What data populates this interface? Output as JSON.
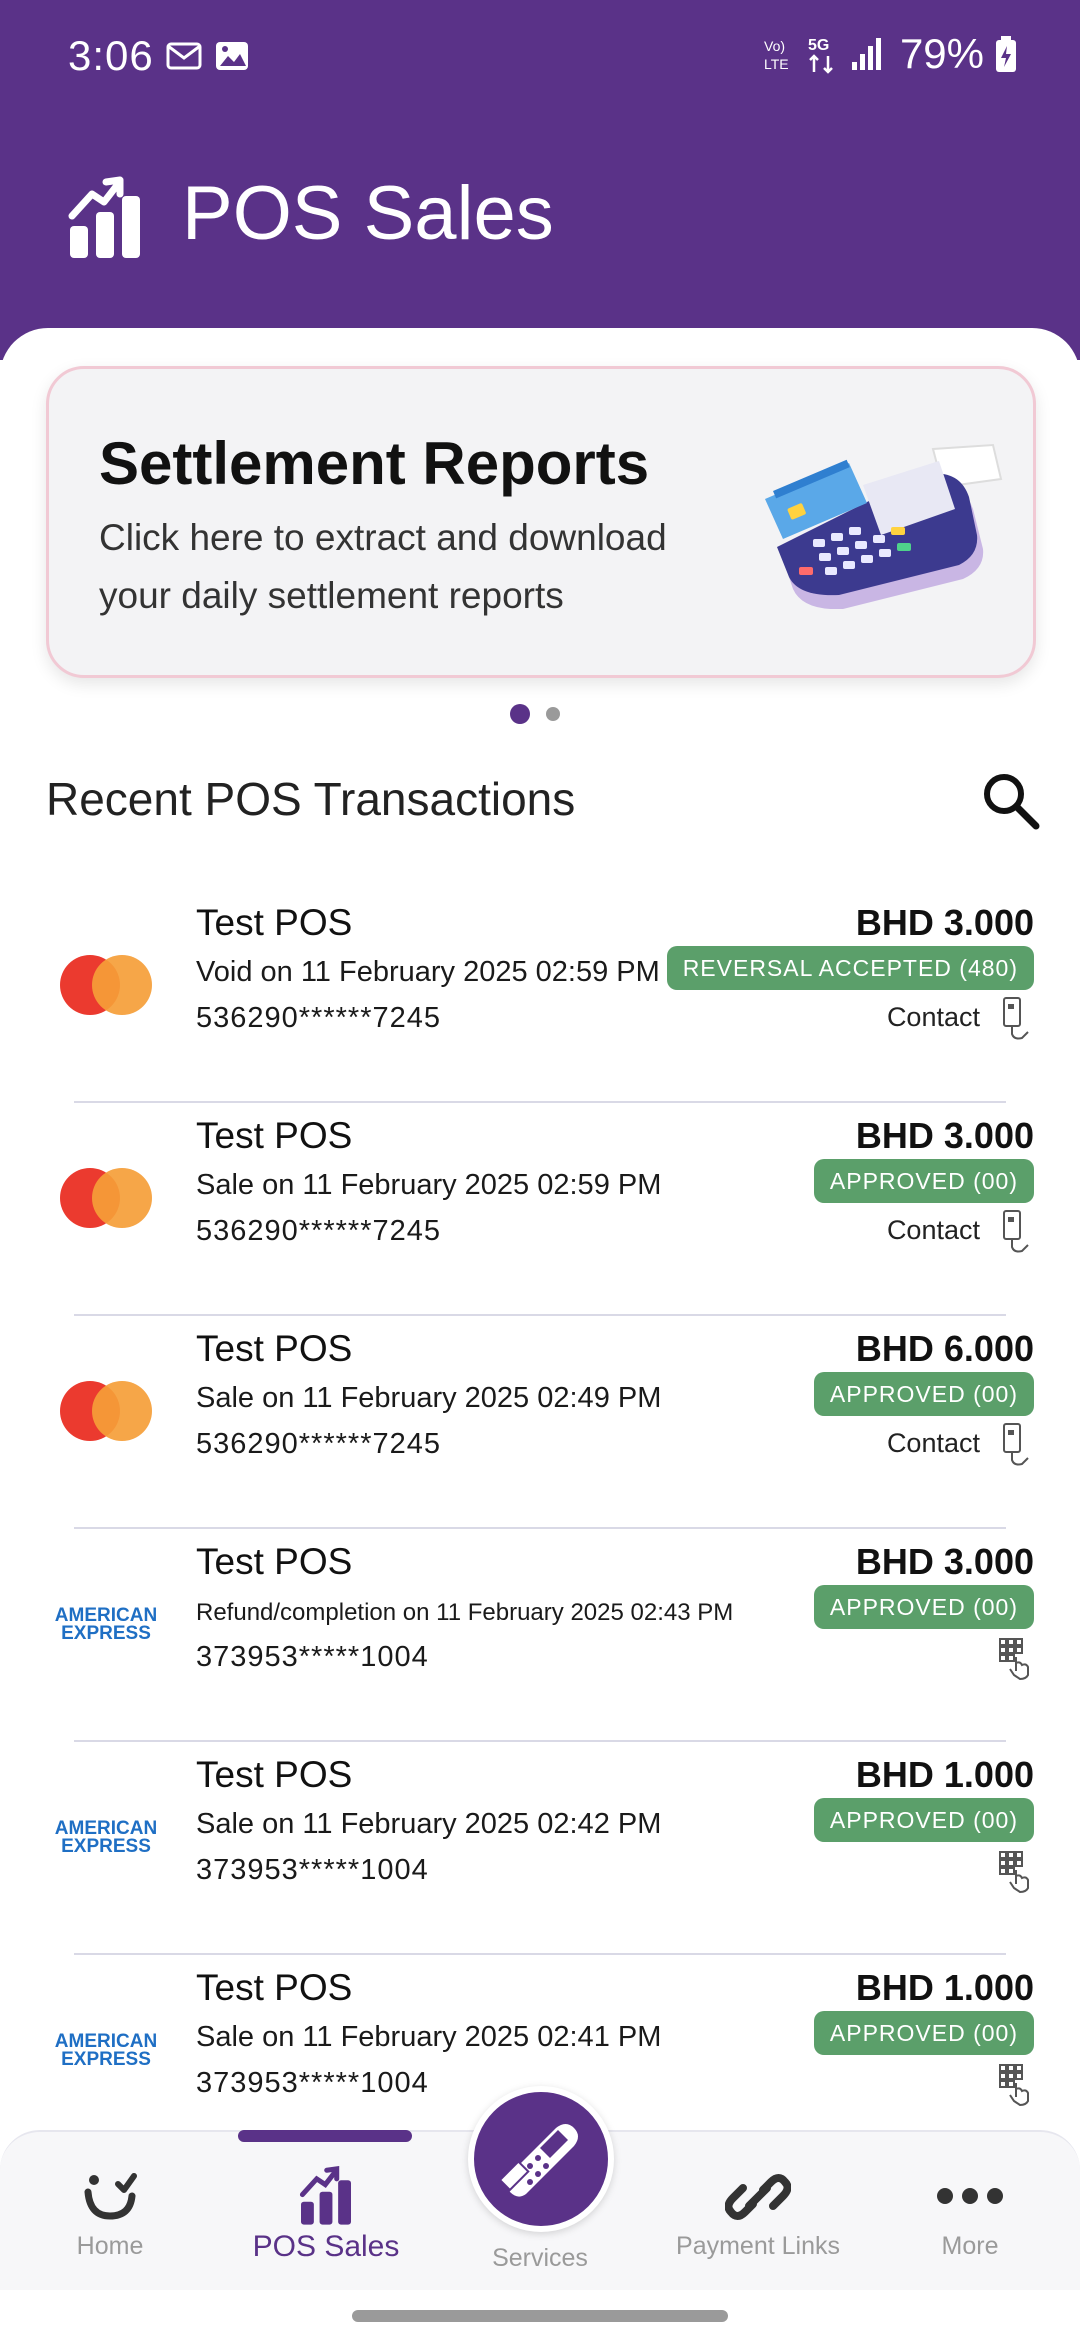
{
  "status_bar": {
    "time": "3:06",
    "battery": "79%",
    "network": "5G"
  },
  "header": {
    "title": "POS Sales",
    "icon": "bar-chart-trend-icon"
  },
  "banner": {
    "title": "Settlement Reports",
    "subtitle": "Click here to extract and download your daily settlement reports",
    "active_page": 1,
    "pages": 2
  },
  "recent": {
    "title": "Recent POS Transactions"
  },
  "transactions": [
    {
      "brand": "mastercard",
      "merchant": "Test POS",
      "description": "Void on 11 February 2025 02:59 PM",
      "pan": "536290******7245",
      "amount": "BHD 3.000",
      "status": "REVERSAL ACCEPTED (480)",
      "entry": "Contact"
    },
    {
      "brand": "mastercard",
      "merchant": "Test POS",
      "description": "Sale on 11 February 2025 02:59 PM",
      "pan": "536290******7245",
      "amount": "BHD 3.000",
      "status": "APPROVED (00)",
      "entry": "Contact"
    },
    {
      "brand": "mastercard",
      "merchant": "Test POS",
      "description": "Sale on 11 February 2025 02:49 PM",
      "pan": "536290******7245",
      "amount": "BHD 6.000",
      "status": "APPROVED (00)",
      "entry": "Contact"
    },
    {
      "brand": "amex",
      "merchant": "Test POS",
      "description": "Refund/completion on 11 February 2025 02:43 PM",
      "pan": "373953*****1004",
      "amount": "BHD 3.000",
      "status": "APPROVED (00)",
      "entry": ""
    },
    {
      "brand": "amex",
      "merchant": "Test POS",
      "description": "Sale on 11 February 2025 02:42 PM",
      "pan": "373953*****1004",
      "amount": "BHD 1.000",
      "status": "APPROVED (00)",
      "entry": ""
    },
    {
      "brand": "amex",
      "merchant": "Test POS",
      "description": "Sale on 11 February 2025 02:41 PM",
      "pan": "373953*****1004",
      "amount": "BHD 1.000",
      "status": "APPROVED (00)",
      "entry": ""
    }
  ],
  "brand_labels": {
    "amex_line1": "AMERICAN",
    "amex_line2": "EXPRESS"
  },
  "nav": {
    "home": "Home",
    "pos_sales": "POS Sales",
    "services": "Services",
    "payment_links": "Payment Links",
    "more": "More"
  },
  "colors": {
    "brand_purple": "#5a3288",
    "approved_green": "#5b9f6a",
    "mastercard_red": "#eb3a2f",
    "mastercard_orange": "#f59e38",
    "amex_blue": "#1f6fc4"
  }
}
